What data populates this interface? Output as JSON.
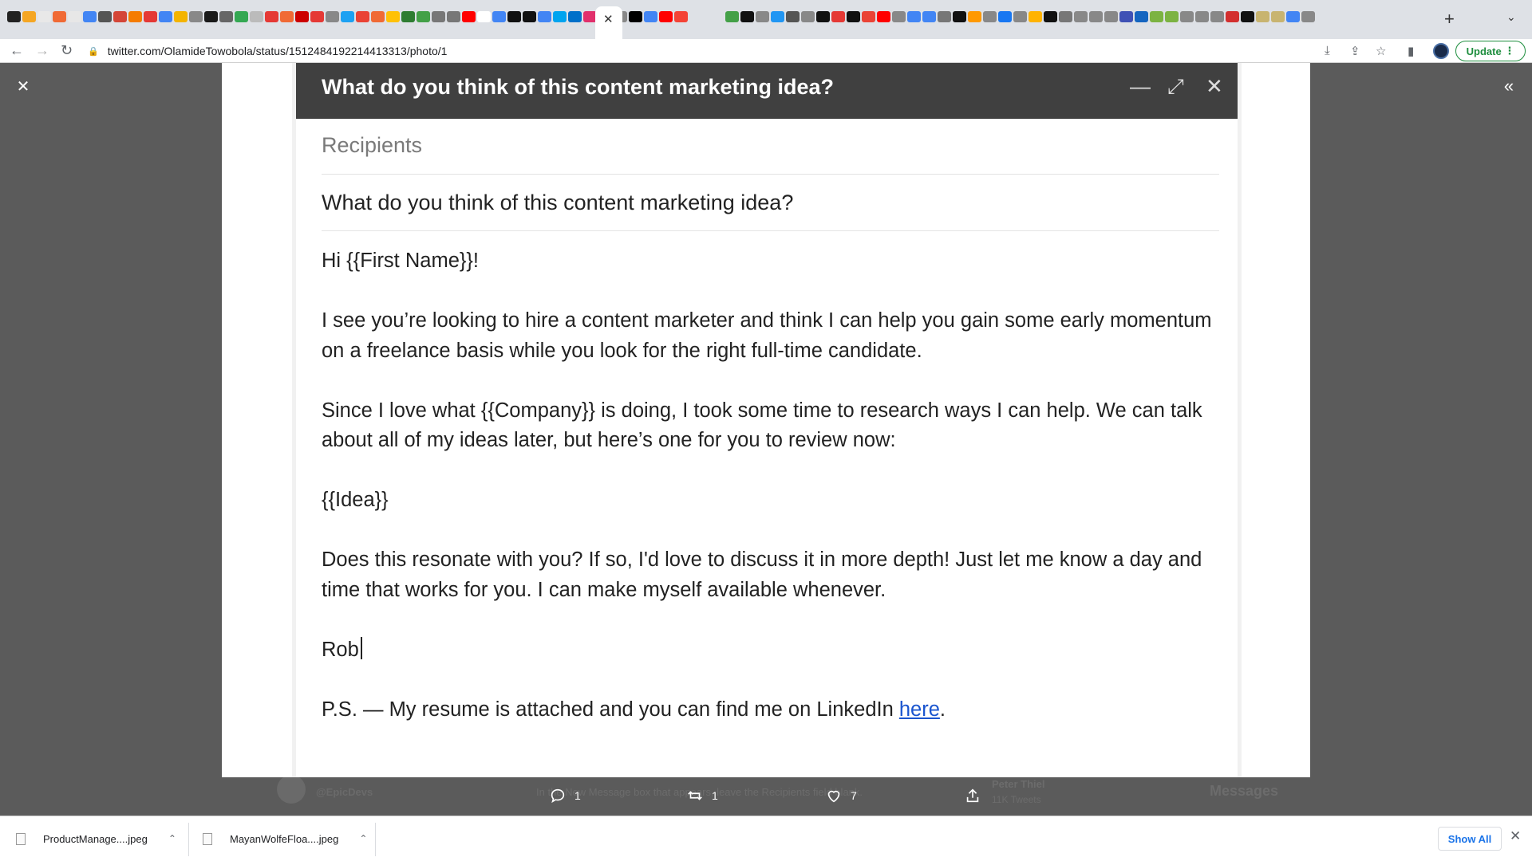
{
  "browser": {
    "active_tab_close": "✕",
    "new_tab": "+",
    "tab_search": "⌄",
    "url": "twitter.com/OlamideTowobola/status/1512484192214413313/photo/1",
    "update_label": "Update",
    "favicon_colors": [
      "#222",
      "#f5a623",
      "#e8e8e8",
      "#f06a35",
      "#e7e7e7",
      "#4285f4",
      "#555",
      "#d44638",
      "#f57c00",
      "#e53935",
      "#4285f4",
      "#f4b400",
      "#888",
      "#1a1a1a",
      "#666",
      "#34a853",
      "#bbb",
      "#e53935",
      "#f06a35",
      "#c00",
      "#e53935",
      "#888",
      "#1da1f2",
      "#ea4335",
      "#f06a35",
      "#ffc107",
      "#2e7d32",
      "#43a047",
      "#777",
      "#777",
      "#ff0000",
      "#fff",
      "#4285f4",
      "#111",
      "#111",
      "#4285f4",
      "#00a4ef",
      "#0070c9",
      "#e1306c",
      "#1c1c1c",
      "#888",
      "#000",
      "#4285f4",
      "#ff0000",
      "#f44336",
      "#43a047",
      "#111",
      "#888",
      "#2196f3",
      "#555",
      "#888",
      "#111",
      "#e53935",
      "#111",
      "#ea4335",
      "#ff0000",
      "#888",
      "#4285f4",
      "#4285f4",
      "#777",
      "#111",
      "#ff9900",
      "#888",
      "#1877f2",
      "#888",
      "#ffb300",
      "#111",
      "#777",
      "#888",
      "#888",
      "#888",
      "#3f51b5",
      "#1565c0",
      "#7cb342",
      "#7cb342",
      "#888",
      "#888",
      "#888",
      "#d32f2f",
      "#111",
      "#c8b470",
      "#c8b470",
      "#4285f4",
      "#888"
    ]
  },
  "lightbox": {
    "close_icon": "✕",
    "expand_icon": "«"
  },
  "compose": {
    "header_title": "What do you think of this content marketing idea?",
    "minimize": "—",
    "expand": "⤢",
    "close": "✕",
    "recipients": "Recipients",
    "subject": "What do you think of this content marketing idea?",
    "greeting": "Hi {{First Name}}!",
    "para1": "I see you’re looking to hire a content marketer and think I can help you gain some early momentum on a freelance basis while you look for the right full-time candidate.",
    "para2": "Since I love what {{Company}} is doing, I took some time to research ways I can help. We can talk about all of my ideas later, but here’s one for you to review now:",
    "idea": "{{Idea}}",
    "para3": "Does this resonate with you? If so, I'd love to discuss it in more depth! Just let me know a day and time that works for you. I can make myself available whenever.",
    "signature": "Rob",
    "ps_text": "P.S. — My resume is attached and you can find me on LinkedIn ",
    "ps_link": "here",
    "ps_end": "."
  },
  "background_tweet": {
    "handle": "@EpicDevs",
    "hint": "In the New Message box that appears, leave the Recipients field blank.",
    "sidebar_name": "Peter Thiel",
    "sidebar_sub": "11K Tweets",
    "messages_label": "Messages"
  },
  "actions": {
    "reply_count": "1",
    "retweet_count": "1",
    "like_count": "7"
  },
  "downloads": {
    "items": [
      {
        "name": "ProductManage....jpeg"
      },
      {
        "name": "MayanWolfeFloa....jpeg"
      }
    ],
    "show_all": "Show All",
    "close": "✕"
  }
}
